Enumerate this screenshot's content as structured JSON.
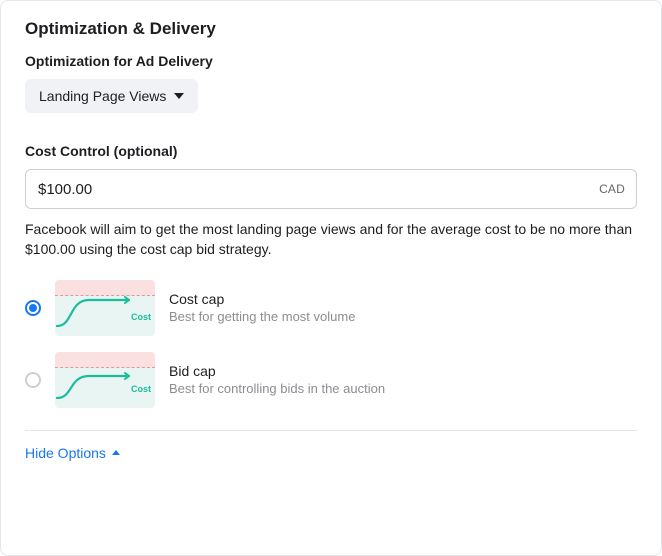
{
  "section_title": "Optimization & Delivery",
  "optimization": {
    "label": "Optimization for Ad Delivery",
    "selected": "Landing Page Views"
  },
  "cost_control": {
    "label": "Cost Control (optional)",
    "value": "$100.00",
    "currency": "CAD",
    "help_text": "Facebook will aim to get the most landing page views and for the average cost to be no more than $100.00 using the cost cap bid strategy."
  },
  "strategies": {
    "thumb_label": "Cost",
    "cost_cap": {
      "title": "Cost cap",
      "desc": "Best for getting the most volume"
    },
    "bid_cap": {
      "title": "Bid cap",
      "desc": "Best for controlling bids in the auction"
    }
  },
  "hide_options": "Hide Options"
}
